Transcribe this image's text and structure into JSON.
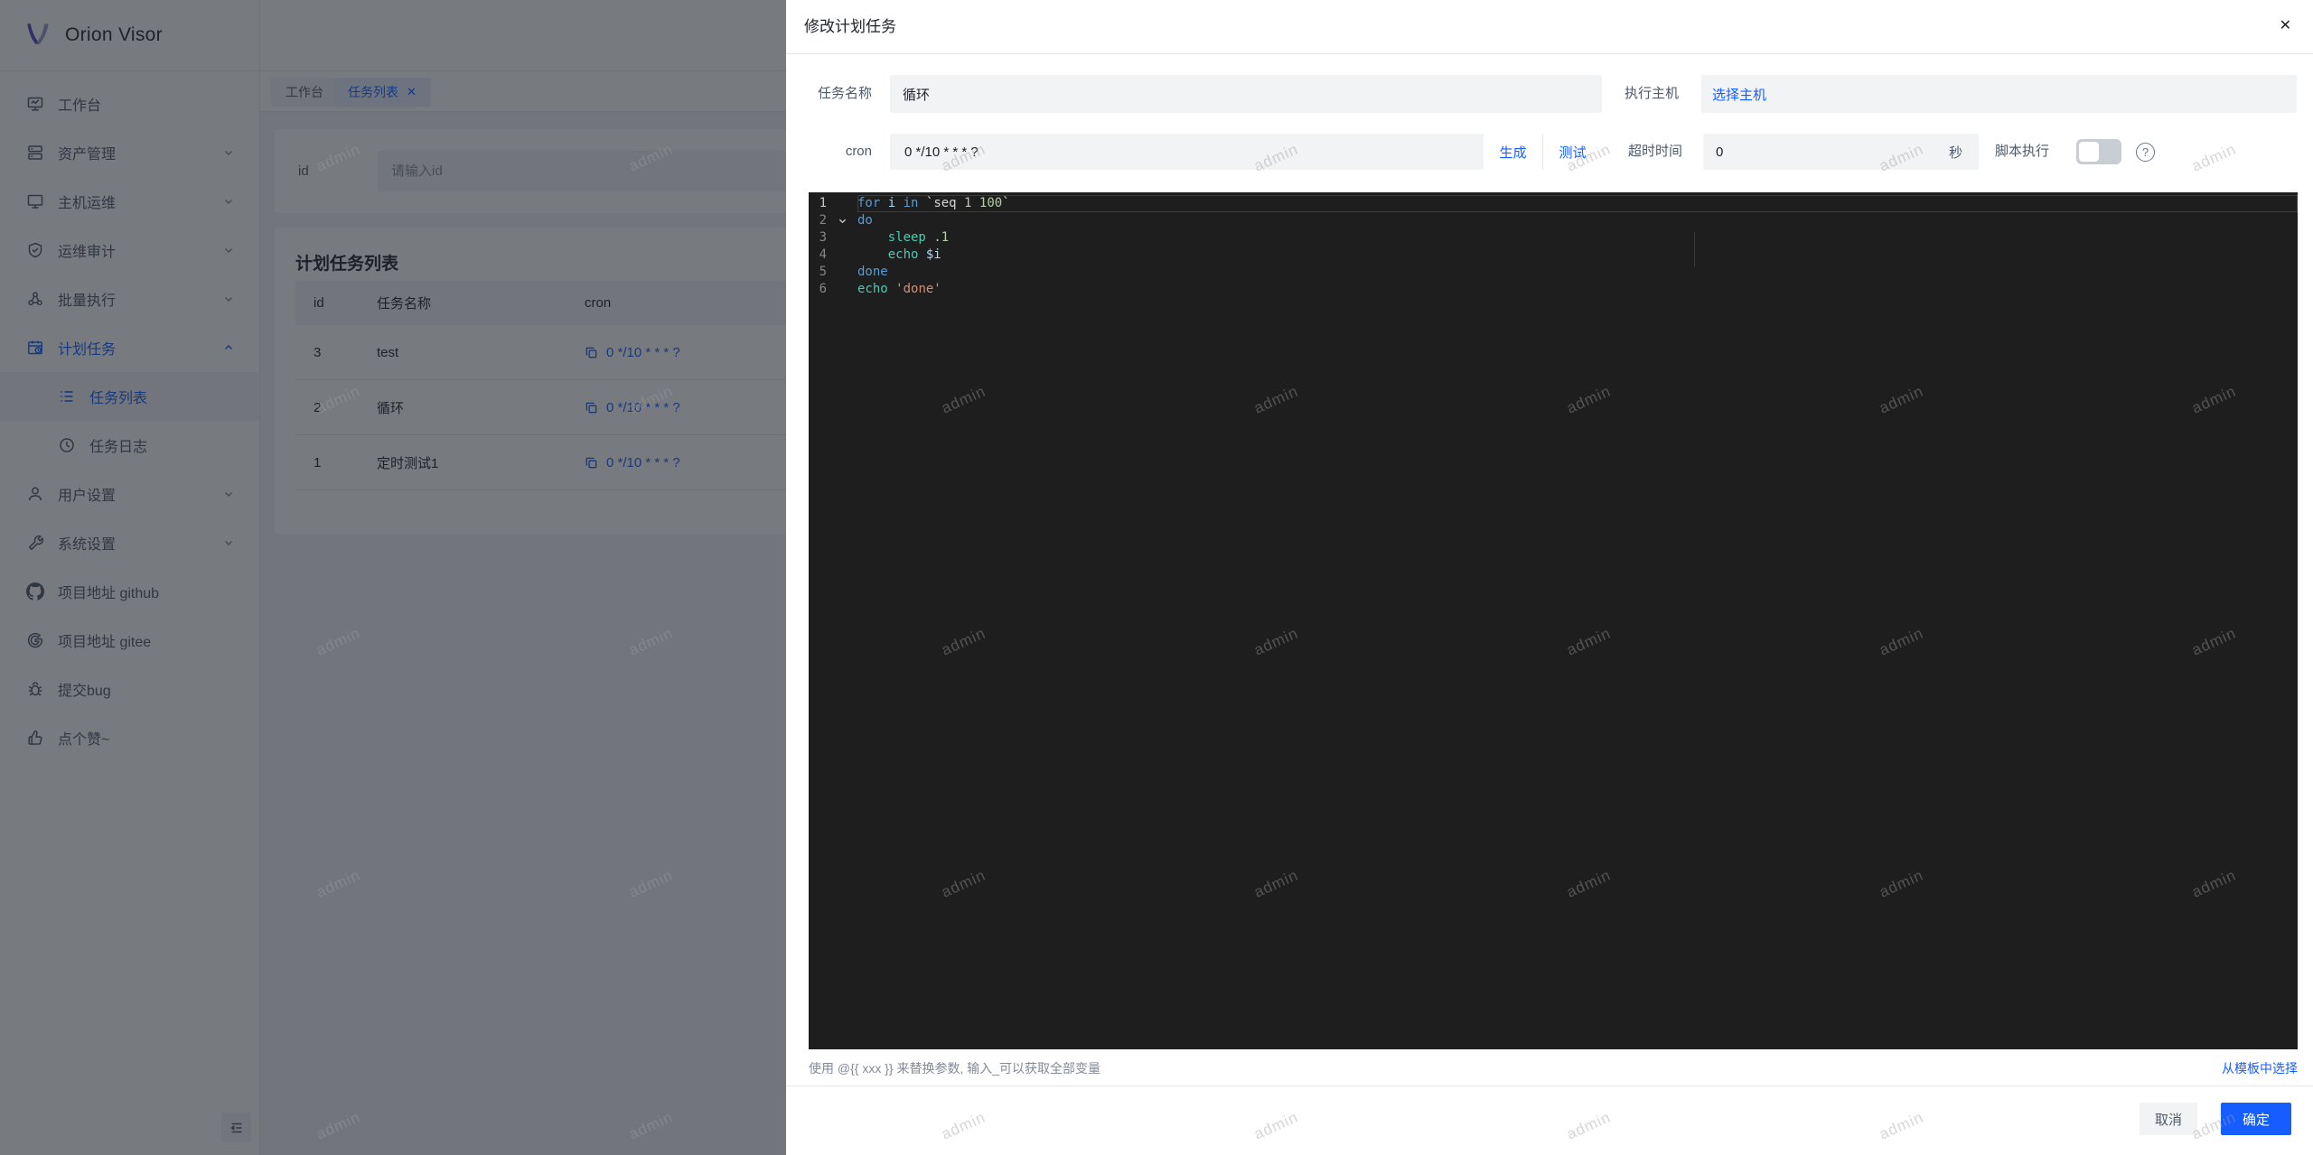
{
  "app": {
    "logo_text": "Orion Visor"
  },
  "colors": {
    "primary": "#165dff",
    "editor_bg": "#1e1e1e",
    "token_keyword": "#569cd6",
    "token_function": "#4ec9b0",
    "token_variable": "#9cdcfe",
    "token_number": "#b5cea8",
    "token_string": "#ce9178"
  },
  "sidebar": {
    "items": [
      {
        "label": "工作台",
        "icon": "desktop-icon"
      },
      {
        "label": "资产管理",
        "icon": "server-icon",
        "chevron": "down"
      },
      {
        "label": "主机运维",
        "icon": "monitor-icon",
        "chevron": "down"
      },
      {
        "label": "运维审计",
        "icon": "shield-icon",
        "chevron": "down"
      },
      {
        "label": "批量执行",
        "icon": "nodes-icon",
        "chevron": "down"
      },
      {
        "label": "计划任务",
        "icon": "schedule-icon",
        "chevron": "up",
        "active": true
      },
      {
        "label": "任务列表",
        "icon": "list-icon",
        "sub": true,
        "selected": true
      },
      {
        "label": "任务日志",
        "icon": "clock-icon",
        "sub": true
      },
      {
        "label": "用户设置",
        "icon": "user-icon",
        "chevron": "down"
      },
      {
        "label": "系统设置",
        "icon": "wrench-icon",
        "chevron": "down"
      },
      {
        "label": "项目地址 github",
        "icon": "github-icon"
      },
      {
        "label": "项目地址 gitee",
        "icon": "gitee-icon"
      },
      {
        "label": "提交bug",
        "icon": "bug-icon"
      },
      {
        "label": "点个赞~",
        "icon": "thumbs-up-icon"
      }
    ]
  },
  "tabs": [
    {
      "label": "工作台"
    },
    {
      "label": "任务列表",
      "close": "✕",
      "active": true
    }
  ],
  "filter": {
    "id_label": "id",
    "id_placeholder": "请输入id"
  },
  "table": {
    "title": "计划任务列表",
    "columns": [
      "id",
      "任务名称",
      "cron"
    ],
    "rows": [
      {
        "id": "3",
        "name": "test",
        "cron": "0 */10 * * * ?"
      },
      {
        "id": "2",
        "name": "循环",
        "cron": "0 */10 * * * ?"
      },
      {
        "id": "1",
        "name": "定时测试1",
        "cron": "0 */10 * * * ?"
      }
    ]
  },
  "drawer": {
    "title": "修改计划任务",
    "close_icon": "✕",
    "fields": {
      "name_label": "任务名称",
      "name_value": "循环",
      "host_label": "执行主机",
      "host_link": "选择主机",
      "cron_label": "cron",
      "cron_value": "0 */10 * * * ?",
      "generate_link": "生成",
      "test_link": "测试",
      "timeout_label": "超时时间",
      "timeout_value": "0",
      "timeout_unit": "秒",
      "script_label": "脚本执行",
      "help_icon": "?"
    },
    "editor": {
      "nums": [
        "1",
        "2",
        "3",
        "4",
        "5",
        "6"
      ],
      "lines": [
        [
          "for",
          " ",
          "i",
          " ",
          "in",
          " `seq ",
          "1 100",
          "`"
        ],
        [
          "do"
        ],
        [
          "    ",
          "sleep",
          " ",
          ".1"
        ],
        [
          "    ",
          "echo",
          " ",
          "$i"
        ],
        [
          "done"
        ],
        [
          "echo",
          " ",
          "'done'"
        ]
      ]
    },
    "hint": "使用 @{{ xxx }} 来替换参数, 输入_可以获取全部变量",
    "template_link": "从模板中选择",
    "cancel_label": "取消",
    "ok_label": "确定"
  },
  "watermark": {
    "text": "admin"
  }
}
